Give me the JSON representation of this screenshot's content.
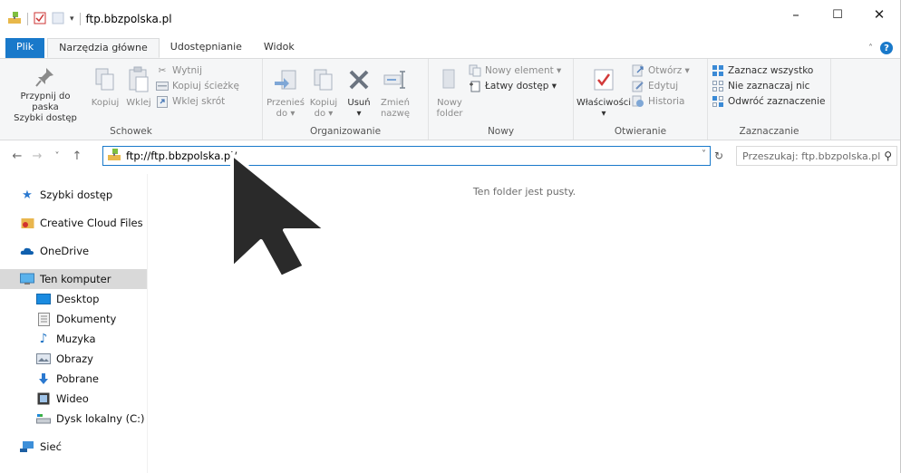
{
  "window": {
    "title": "ftp.bbzpolska.pl",
    "controls": {
      "minimize": "–",
      "maximize": "☐",
      "close": "✕"
    }
  },
  "tabs": [
    {
      "label": "Plik"
    },
    {
      "label": "Narzędzia główne"
    },
    {
      "label": "Udostępnianie"
    },
    {
      "label": "Widok"
    }
  ],
  "ribbon": {
    "schowek": {
      "label": "Schowek",
      "pin": "Przypnij do paska\nSzybki dostęp",
      "copy": "Kopiuj",
      "paste": "Wklej",
      "cut": "Wytnij",
      "copy_path": "Kopiuj ścieżkę",
      "paste_shortcut": "Wklej skrót"
    },
    "organizowanie": {
      "label": "Organizowanie",
      "move": "Przenieś\ndo ▾",
      "copy_to": "Kopiuj\ndo ▾",
      "delete": "Usuń\n▾",
      "rename": "Zmień\nnazwę"
    },
    "nowy": {
      "label": "Nowy",
      "new_folder": "Nowy\nfolder",
      "new_item": "Nowy element ▾",
      "easy_access": "Łatwy dostęp ▾"
    },
    "otwieranie": {
      "label": "Otwieranie",
      "properties": "Właściwości\n▾",
      "open": "Otwórz ▾",
      "edit": "Edytuj",
      "history": "Historia"
    },
    "zaznaczanie": {
      "label": "Zaznaczanie",
      "select_all": "Zaznacz wszystko",
      "select_none": "Nie zaznaczaj nic",
      "invert": "Odwróć zaznaczenie"
    }
  },
  "nav": {
    "back": "←",
    "forward": "→",
    "recent": "˅",
    "up": "↑",
    "address": "ftp://ftp.bbzpolska.pl/",
    "search_placeholder": "Przeszukaj: ftp.bbzpolska.pl"
  },
  "sidebar": {
    "quick_access": "Szybki dostęp",
    "creative_cloud": "Creative Cloud Files",
    "onedrive": "OneDrive",
    "this_pc": "Ten komputer",
    "desktop": "Desktop",
    "documents": "Dokumenty",
    "music": "Muzyka",
    "pictures": "Obrazy",
    "downloads": "Pobrane",
    "videos": "Wideo",
    "local_disk": "Dysk lokalny (C:)",
    "network": "Sieć"
  },
  "content": {
    "empty_message": "Ten folder jest pusty."
  },
  "colors": {
    "accent": "#1979ca",
    "selected": "#d9d9d9",
    "ribbon_bg": "#f5f6f7"
  }
}
